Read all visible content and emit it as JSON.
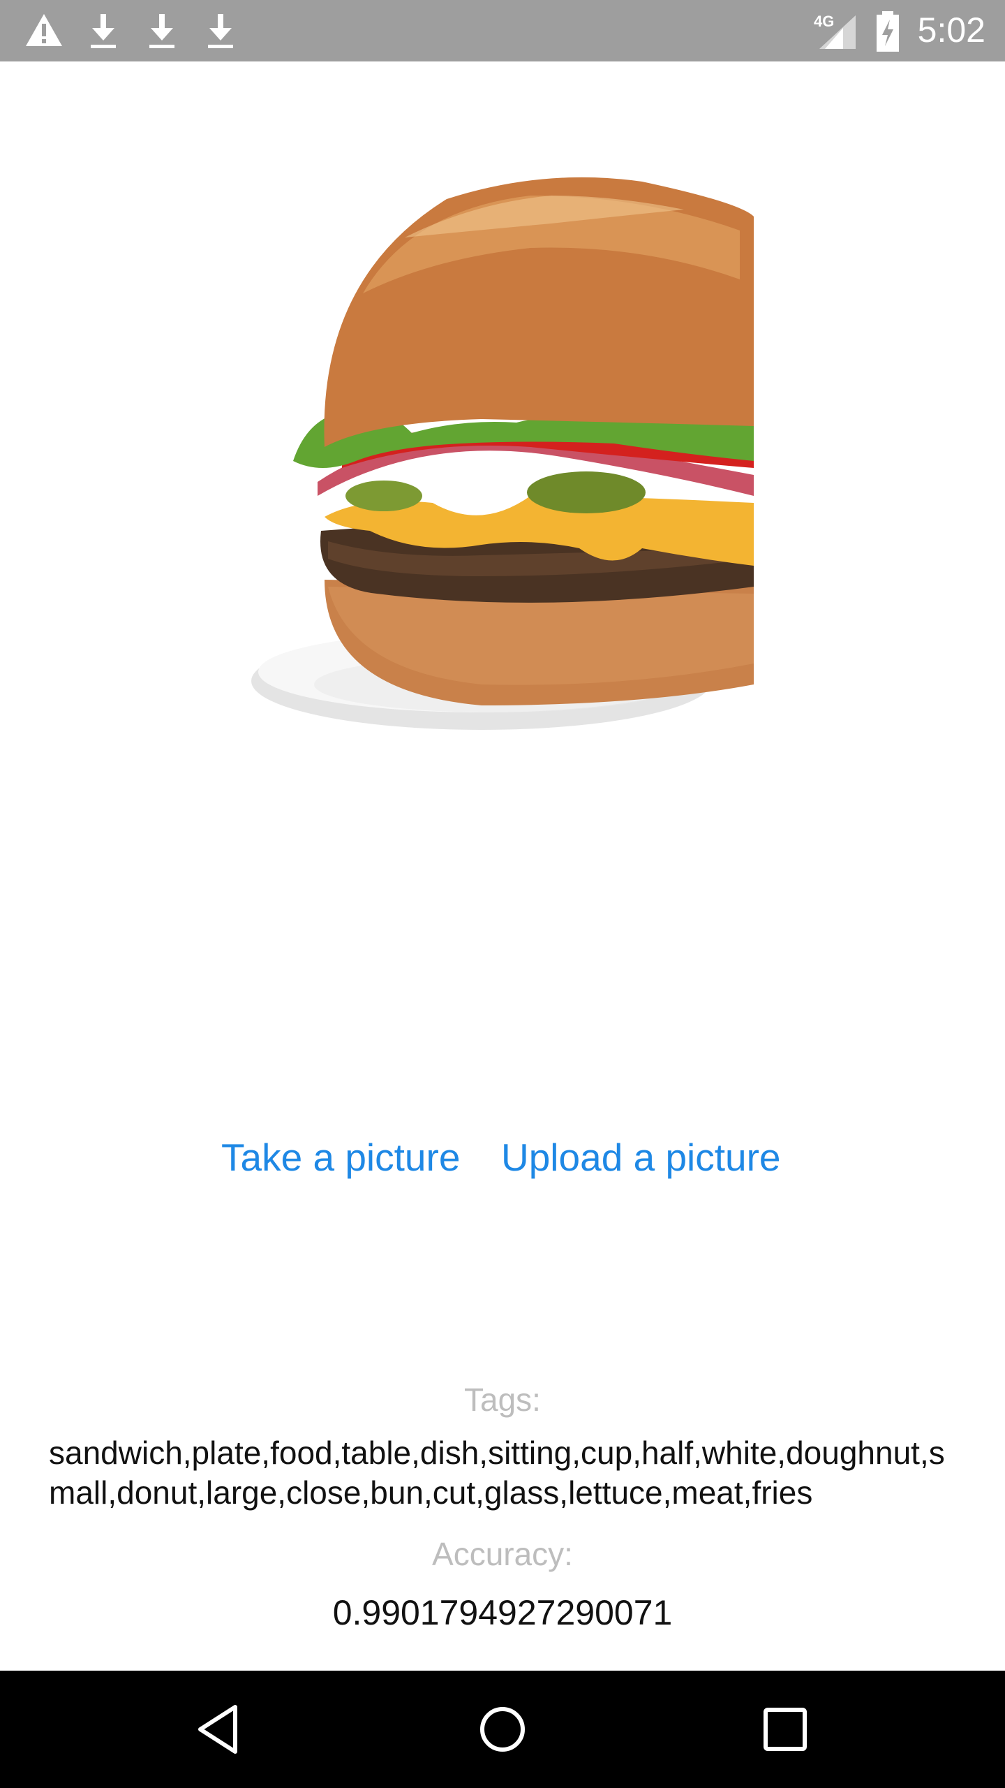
{
  "status_bar": {
    "time": "5:02",
    "network": "4G",
    "icons": [
      "warning-icon",
      "download-icon",
      "download-icon",
      "download-icon",
      "signal-icon",
      "battery-charging-icon"
    ]
  },
  "image": {
    "subject": "cheeseburger-on-plate"
  },
  "actions": {
    "take_picture": "Take a picture",
    "upload_picture": "Upload a picture"
  },
  "results": {
    "tags_label": "Tags:",
    "tags_value": "sandwich,plate,food,table,dish,sitting,cup,half,white,doughnut,small,donut,large,close,bun,cut,glass,lettuce,meat,fries",
    "accuracy_label": "Accuracy:",
    "accuracy_value": "0.9901794927290071"
  },
  "nav": {
    "icons": [
      "back-icon",
      "home-icon",
      "recents-icon"
    ]
  },
  "colors": {
    "accent": "#1e88e5",
    "status_bar": "#9e9e9e",
    "muted": "#bdbdbd",
    "nav_bar": "#000000"
  }
}
